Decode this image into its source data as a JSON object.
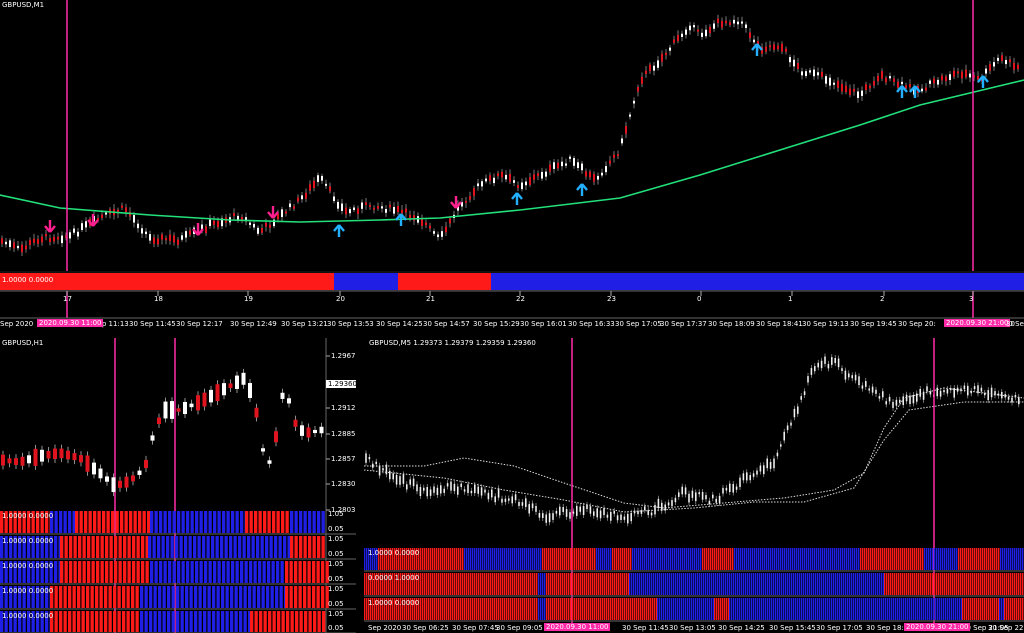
{
  "colors": {
    "bull": "#ffffff",
    "bear": "#e0141e",
    "up_arrow": "#22b0ff",
    "down_arrow": "#ff1f8f",
    "vline": "#ff2aa8",
    "ma": "#22e07a",
    "ind_red": "#ff1a1a",
    "ind_blue": "#1f1fe6"
  },
  "top": {
    "title": "GBPUSD,M1",
    "ind_label": "1.0000 0.0000",
    "hour_labels": [
      "17",
      "18",
      "19",
      "20",
      "21",
      "22",
      "23",
      "0",
      "1",
      "2",
      "3"
    ],
    "time_labels": [
      "Sep 2020",
      "30 Sep 11:13",
      "30 Sep 11:45",
      "30 Sep 12:17",
      "30 Sep 12:49",
      "30 Sep 13:21",
      "30 Sep 13:53",
      "30 Sep 14:25",
      "30 Sep 14:57",
      "30 Sep 15:29",
      "30 Sep 16:01",
      "30 Sep 16:33",
      "30 Sep 17:05",
      "30 Sep 17:37",
      "30 Sep 18:09",
      "30 Sep 18:41",
      "30 Sep 19:13",
      "30 Sep 19:45",
      "30 Sep 20:",
      "30 Sep"
    ],
    "hl1": "2020.09.30 11:00",
    "hl2": "2020.09.30 21:00",
    "hl2_tail": "30"
  },
  "left": {
    "title": "GBPUSD,H1",
    "price_labels": [
      "1.2967",
      "1.2939",
      "1.2912",
      "1.2885",
      "1.2857",
      "1.2830",
      "1.2803"
    ],
    "current": "1.29360",
    "ind_labels": [
      "1.0000 0.0000",
      "1.0000 0.0000",
      "1.0000 0.0000",
      "1.0000 0.0000",
      "1.0000 0.0000"
    ],
    "ind_scale": [
      "1.05",
      "0.05"
    ]
  },
  "right": {
    "title": "GBPUSD,M5  1.29373 1.29379 1.29359 1.29360",
    "ind_labels": [
      "1.0000 0.0000",
      "0.0000 1.0000",
      "1.0000 0.0000"
    ],
    "time_labels": [
      "Sep 2020",
      "30 Sep 06:25",
      "30 Sep 07:45",
      "30 Sep 09:05",
      "30 Sep 11:45",
      "30 Sep 13:05",
      "30 Sep 14:25",
      "30 Sep 15:45",
      "30 Sep 17:05",
      "30 Sep 18:25",
      "30 Sep 21:05",
      "30 Sep 22:25"
    ],
    "hl1": "2020.09.30 11:00",
    "hl2": "2020.09.30 21:00"
  }
}
